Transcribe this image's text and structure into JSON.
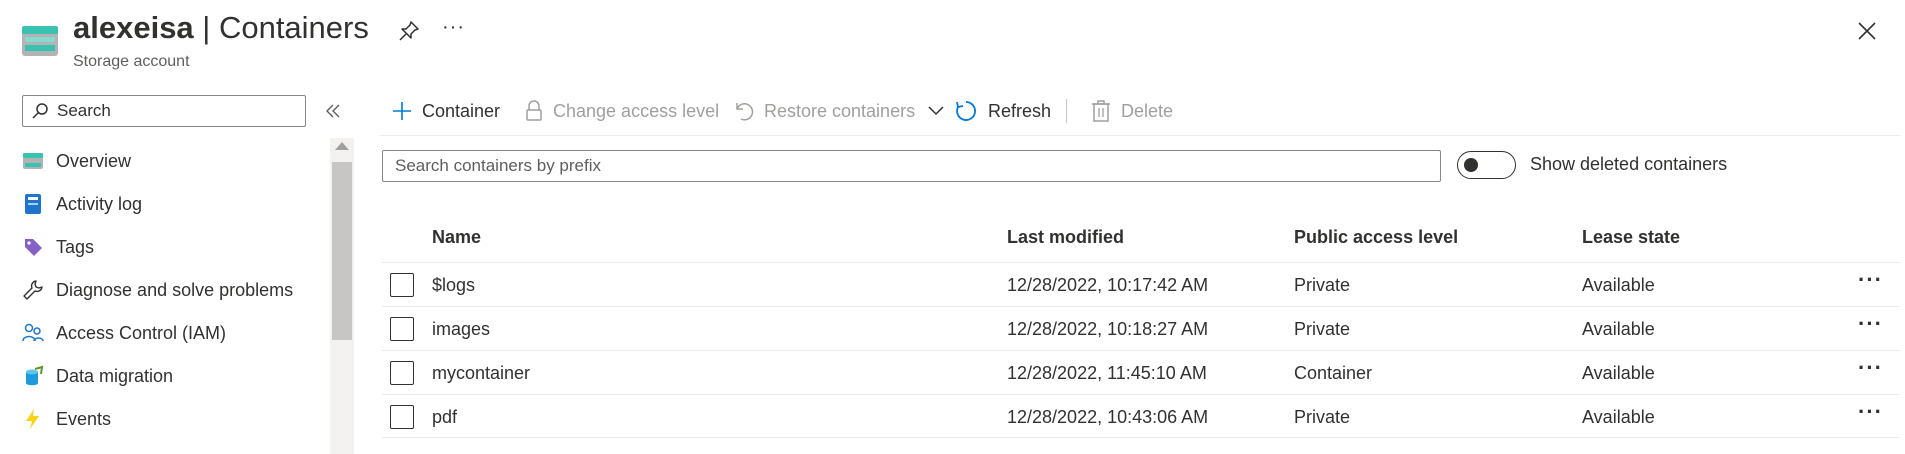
{
  "header": {
    "title_bold": "alexeisa",
    "title_rest": " | Containers",
    "subtitle": "Storage account",
    "more_label": "···"
  },
  "sidebar": {
    "search_placeholder": "Search",
    "items": [
      {
        "label": "Overview",
        "icon": "overview-icon"
      },
      {
        "label": "Activity log",
        "icon": "activity-log-icon"
      },
      {
        "label": "Tags",
        "icon": "tag-icon"
      },
      {
        "label": "Diagnose and solve problems",
        "icon": "wrench-icon"
      },
      {
        "label": "Access Control (IAM)",
        "icon": "people-icon"
      },
      {
        "label": "Data migration",
        "icon": "data-migration-icon"
      },
      {
        "label": "Events",
        "icon": "lightning-icon"
      }
    ]
  },
  "toolbar": {
    "container_label": "Container",
    "change_access_label": "Change access level",
    "restore_label": "Restore containers",
    "refresh_label": "Refresh",
    "delete_label": "Delete"
  },
  "filter": {
    "prefix_placeholder": "Search containers by prefix",
    "show_deleted_label": "Show deleted containers",
    "show_deleted_on": false
  },
  "table": {
    "columns": {
      "name": "Name",
      "last_modified": "Last modified",
      "public_access": "Public access level",
      "lease_state": "Lease state"
    },
    "rows": [
      {
        "name": "$logs",
        "last_modified": "12/28/2022, 10:17:42 AM",
        "public_access": "Private",
        "lease_state": "Available"
      },
      {
        "name": "images",
        "last_modified": "12/28/2022, 10:18:27 AM",
        "public_access": "Private",
        "lease_state": "Available"
      },
      {
        "name": "mycontainer",
        "last_modified": "12/28/2022, 11:45:10 AM",
        "public_access": "Container",
        "lease_state": "Available"
      },
      {
        "name": "pdf",
        "last_modified": "12/28/2022, 10:43:06 AM",
        "public_access": "Private",
        "lease_state": "Available"
      }
    ],
    "row_more_label": "···"
  },
  "colors": {
    "accent": "#0078d4",
    "disabled": "#a19f9d",
    "text": "#323130"
  }
}
